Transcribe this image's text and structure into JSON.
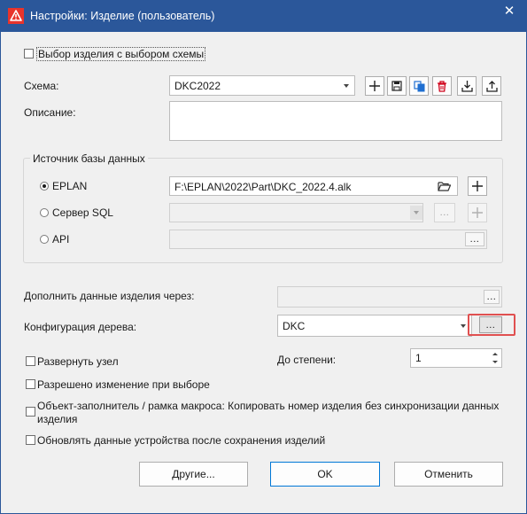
{
  "window": {
    "title": "Настройки: Изделие (пользователь)",
    "close_glyph": "✕"
  },
  "select_with_scheme": {
    "label": "Выбор изделия с выбором схемы",
    "checked": false
  },
  "scheme": {
    "label": "Схема:",
    "value": "DKC2022"
  },
  "toolbar": {
    "icons": [
      "add-icon",
      "save-icon",
      "copy-icon",
      "delete-icon",
      "import-icon",
      "export-icon"
    ],
    "delete_color": "#d0021b",
    "copy_color": "#1f6fd1"
  },
  "description": {
    "label": "Описание:",
    "value": ""
  },
  "db_source": {
    "group_title": "Источник базы данных",
    "eplan_label": "EPLAN",
    "eplan_path": "F:\\EPLAN\\2022\\Part\\DKC_2022.4.alk",
    "sql_label": "Сервер SQL",
    "sql_value": "",
    "api_label": "API",
    "api_value": "",
    "selected": "EPLAN"
  },
  "supplement": {
    "label": "Дополнить данные изделия через:",
    "value": "",
    "browse": "..."
  },
  "tree_config": {
    "label": "Конфигурация дерева:",
    "value": "DKC",
    "browse": "...",
    "highlight_color": "#e05050"
  },
  "expand_node": {
    "label": "Развернуть узел",
    "checked": false
  },
  "degree": {
    "label": "До степени:",
    "value": "1"
  },
  "allow_change": {
    "label": "Разрешено изменение при выборе",
    "checked": false
  },
  "placeholder_object": {
    "label_line1": "Объект-заполнитель / рамка макроса: Копировать номер изделия без синхронизации данных",
    "label_line2": "изделия",
    "checked": false
  },
  "update_device": {
    "label": "Обновлять данные устройства после сохранения изделий",
    "checked": false
  },
  "buttons": {
    "others": "Другие...",
    "ok": "OK",
    "cancel": "Отменить"
  },
  "accent_color": "#2b579a"
}
